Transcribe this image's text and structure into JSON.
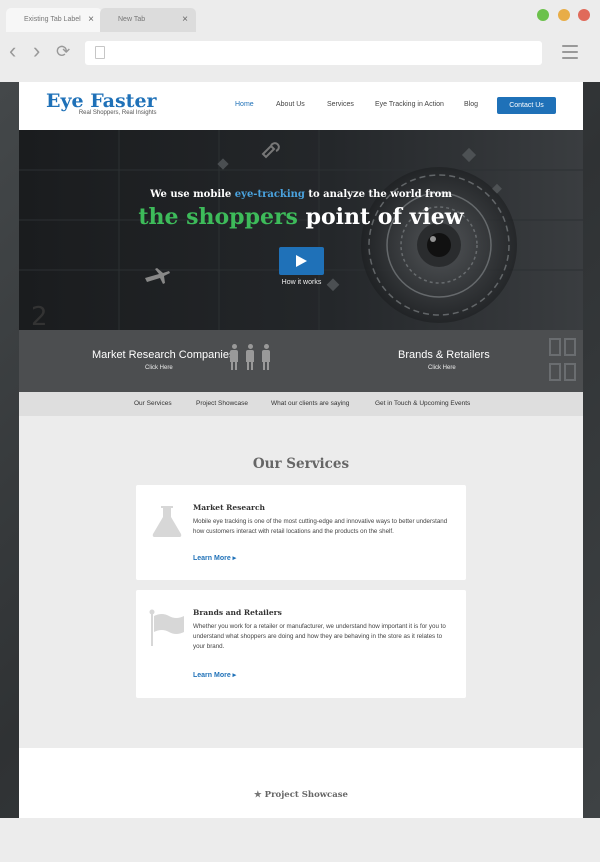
{
  "browser": {
    "tabs": [
      {
        "label": "Existing Tab Label",
        "close": "×"
      },
      {
        "label": "New Tab",
        "close": "×"
      }
    ],
    "nav": {
      "back": "‹",
      "forward": "›",
      "reload": "⟳"
    }
  },
  "site": {
    "logo": {
      "title": "Eye Faster",
      "tagline": "Real Shoppers, Real Insights"
    },
    "menu": [
      "Home",
      "About Us",
      "Services",
      "Eye Tracking in Action",
      "Blog"
    ],
    "contact": "Contact Us"
  },
  "hero": {
    "line1_pre": "We use mobile ",
    "line1_hl": "eye-tracking",
    "line1_post": " to analyze the world from",
    "line2_green": "the shoppers",
    "line2_white": " point of view",
    "play_label": "How it works"
  },
  "segments": [
    {
      "title": "Market Research Companies",
      "link": "Click Here"
    },
    {
      "title": "Brands & Retailers",
      "link": "Click Here"
    }
  ],
  "subnav": [
    "Our Services",
    "Project Showcase",
    "What our clients are saying",
    "Get in Touch & Upcoming Events"
  ],
  "services": {
    "title": "Our Services",
    "cards": [
      {
        "title": "Market Research",
        "text": "Mobile eye tracking is one of the most cutting-edge and innovative ways to better understand how customers interact with retail locations and the products on the shelf.",
        "link": "Learn More ▸",
        "icon": "flask-icon"
      },
      {
        "title": "Brands and Retailers",
        "text": "Whether you work for a retailer or manufacturer, we understand how important it is for you to understand what shoppers are doing and how they are behaving in the store as it relates to your brand.",
        "link": "Learn More ▸",
        "icon": "flag-icon"
      }
    ]
  },
  "showcase": {
    "title": "Project Showcase",
    "icon": "★"
  },
  "colors": {
    "brand_blue": "#1f71b8",
    "accent_green": "#3dbb5a",
    "highlight_blue": "#4aa3df"
  }
}
